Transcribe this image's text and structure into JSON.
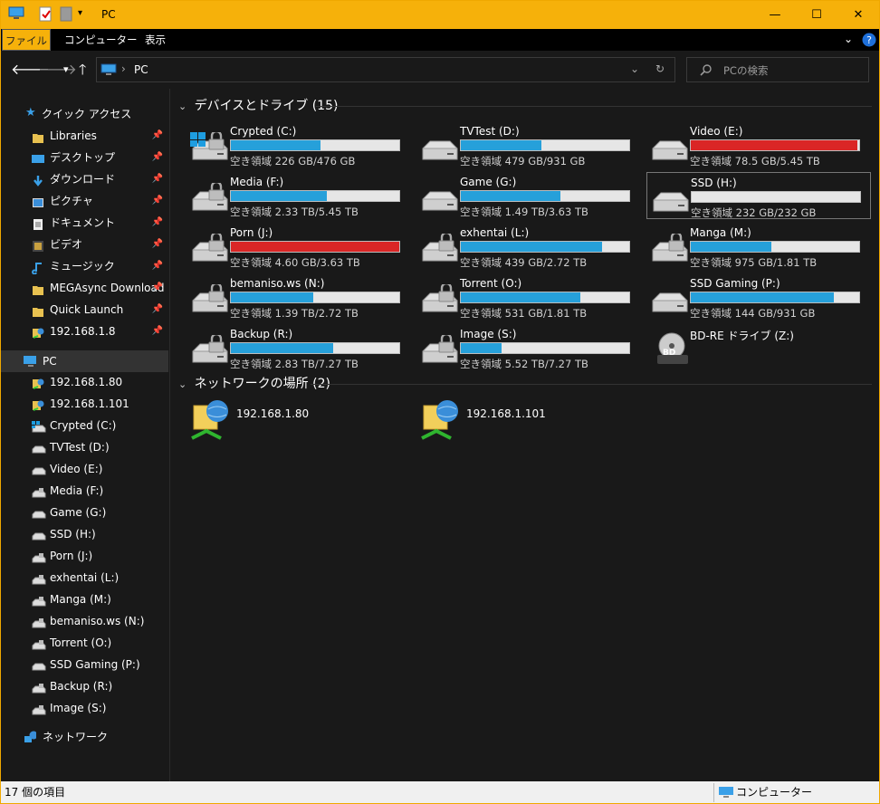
{
  "window": {
    "title": "PC",
    "minimize": "—",
    "maximize": "☐",
    "close": "✕"
  },
  "ribbon": {
    "tabs": [
      "ファイル",
      "コンピューター",
      "表示"
    ]
  },
  "address": {
    "path": "PC",
    "search_placeholder": "PCの検索"
  },
  "sidebar": {
    "quick_access": "クイック アクセス",
    "quick_items": [
      {
        "label": "Libraries",
        "icon": "folder-icon"
      },
      {
        "label": "デスクトップ",
        "icon": "desktop-icon"
      },
      {
        "label": "ダウンロード",
        "icon": "download-icon"
      },
      {
        "label": "ピクチャ",
        "icon": "pictures-icon"
      },
      {
        "label": "ドキュメント",
        "icon": "documents-icon"
      },
      {
        "label": "ビデオ",
        "icon": "videos-icon"
      },
      {
        "label": "ミュージック",
        "icon": "music-icon"
      },
      {
        "label": "MEGAsync Download",
        "icon": "folder-icon"
      },
      {
        "label": "Quick Launch",
        "icon": "folder-icon"
      },
      {
        "label": "192.168.1.8",
        "icon": "network-folder-icon"
      }
    ],
    "pc": "PC",
    "pc_items": [
      "192.168.1.80",
      "192.168.1.101",
      "Crypted (C:)",
      "TVTest (D:)",
      "Video (E:)",
      "Media (F:)",
      "Game (G:)",
      "SSD (H:)",
      "Porn (J:)",
      "exhentai (L:)",
      "Manga (M:)",
      "bemaniso.ws (N:)",
      "Torrent (O:)",
      "SSD Gaming (P:)",
      "Backup (R:)",
      "Image (S:)"
    ],
    "network": "ネットワーク"
  },
  "content": {
    "devices_header": "デバイスとドライブ (15)",
    "network_header": "ネットワークの場所 (2)",
    "drives": [
      {
        "name": "Crypted (C:)",
        "free": "空き領域 226 GB/476 GB",
        "used": 0.53,
        "full": false,
        "locked": true,
        "windows": true
      },
      {
        "name": "TVTest (D:)",
        "free": "空き領域 479 GB/931 GB",
        "used": 0.48,
        "full": false,
        "locked": false
      },
      {
        "name": "Video (E:)",
        "free": "空き領域 78.5 GB/5.45 TB",
        "used": 0.99,
        "full": true,
        "locked": false
      },
      {
        "name": "Media (F:)",
        "free": "空き領域 2.33 TB/5.45 TB",
        "used": 0.57,
        "full": false,
        "locked": true
      },
      {
        "name": "Game (G:)",
        "free": "空き領域 1.49 TB/3.63 TB",
        "used": 0.59,
        "full": false,
        "locked": false
      },
      {
        "name": "SSD (H:)",
        "free": "空き領域 232 GB/232 GB",
        "used": 0.0,
        "full": false,
        "locked": false,
        "selected": true
      },
      {
        "name": "Porn (J:)",
        "free": "空き領域 4.60 GB/3.63 TB",
        "used": 1.0,
        "full": true,
        "locked": true
      },
      {
        "name": "exhentai (L:)",
        "free": "空き領域 439 GB/2.72 TB",
        "used": 0.84,
        "full": false,
        "locked": true
      },
      {
        "name": "Manga (M:)",
        "free": "空き領域 975 GB/1.81 TB",
        "used": 0.48,
        "full": false,
        "locked": true
      },
      {
        "name": "bemaniso.ws (N:)",
        "free": "空き領域 1.39 TB/2.72 TB",
        "used": 0.49,
        "full": false,
        "locked": true
      },
      {
        "name": "Torrent (O:)",
        "free": "空き領域 531 GB/1.81 TB",
        "used": 0.71,
        "full": false,
        "locked": true
      },
      {
        "name": "SSD Gaming (P:)",
        "free": "空き領域 144 GB/931 GB",
        "used": 0.85,
        "full": false,
        "locked": false
      },
      {
        "name": "Backup (R:)",
        "free": "空き領域 2.83 TB/7.27 TB",
        "used": 0.61,
        "full": false,
        "locked": true
      },
      {
        "name": "Image (S:)",
        "free": "空き領域 5.52 TB/7.27 TB",
        "used": 0.24,
        "full": false,
        "locked": true
      },
      {
        "name": "BD-RE ドライブ (Z:)",
        "free": "",
        "used": null,
        "optical": true,
        "disc_label": "BD"
      }
    ],
    "network_locations": [
      "192.168.1.80",
      "192.168.1.101"
    ]
  },
  "status": {
    "count": "17 個の項目",
    "right": "コンピューター"
  },
  "colors": {
    "accent": "#f6b10a",
    "bar": "#26a0da",
    "bar_full": "#da2626"
  }
}
